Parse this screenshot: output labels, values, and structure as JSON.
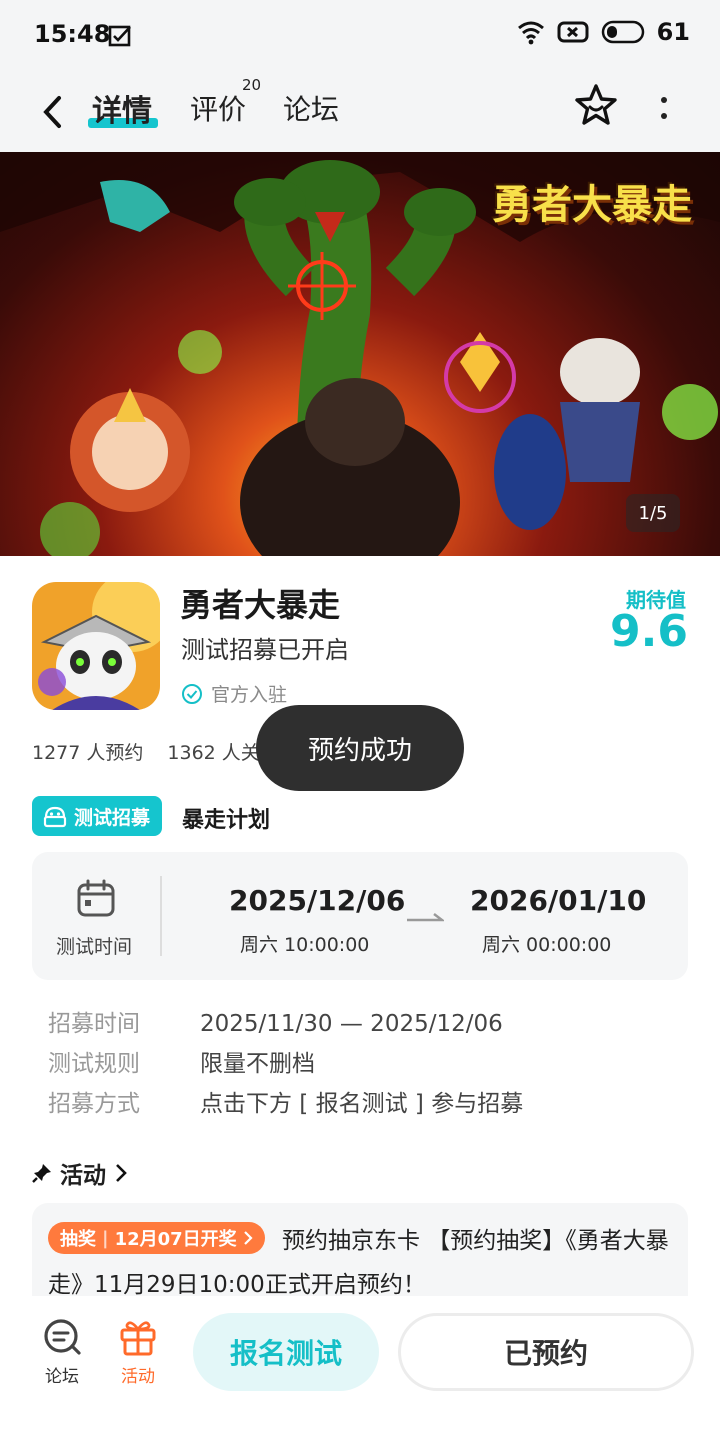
{
  "status_bar": {
    "time": "15:48",
    "battery": "61"
  },
  "nav": {
    "tabs": [
      {
        "label": "详情"
      },
      {
        "label": "评价",
        "badge": "20"
      },
      {
        "label": "论坛"
      }
    ]
  },
  "banner": {
    "logo_text": "勇者大暴走",
    "counter": "1/5"
  },
  "game": {
    "title": "勇者大暴走",
    "subtitle": "测试招募已开启",
    "official": "官方入驻",
    "expect_label": "期待值",
    "expect_value": "9.6",
    "reservations": "1277 人预约",
    "followers": "1362 人关"
  },
  "toast": "预约成功",
  "recruit": {
    "tag": "测试招募",
    "name": "暴走计划",
    "time_label": "测试时间",
    "start_date": "2025/12/06",
    "start_time": "周六  10:00:00",
    "end_date": "2026/01/10",
    "end_time": "周六  00:00:00",
    "rows": [
      {
        "label": "招募时间",
        "value": "2025/11/30 — 2025/12/06"
      },
      {
        "label": "测试规则",
        "value": "限量不删档"
      },
      {
        "label": "招募方式",
        "value": "点击下方 [ 报名测试 ] 参与招募"
      }
    ]
  },
  "activity": {
    "title": "活动",
    "tag_left": "抽奖",
    "tag_right": "12月07日开奖",
    "text": "预约抽京东卡 【预约抽奖】《勇者大暴走》11月29日10:00正式开启预约！"
  },
  "bottom": {
    "forum_label": "论坛",
    "activity_label": "活动",
    "signup_button": "报名测试",
    "reserved_button": "已预约"
  },
  "colors": {
    "accent": "#15c5ce",
    "orange": "#ff7a3d"
  }
}
